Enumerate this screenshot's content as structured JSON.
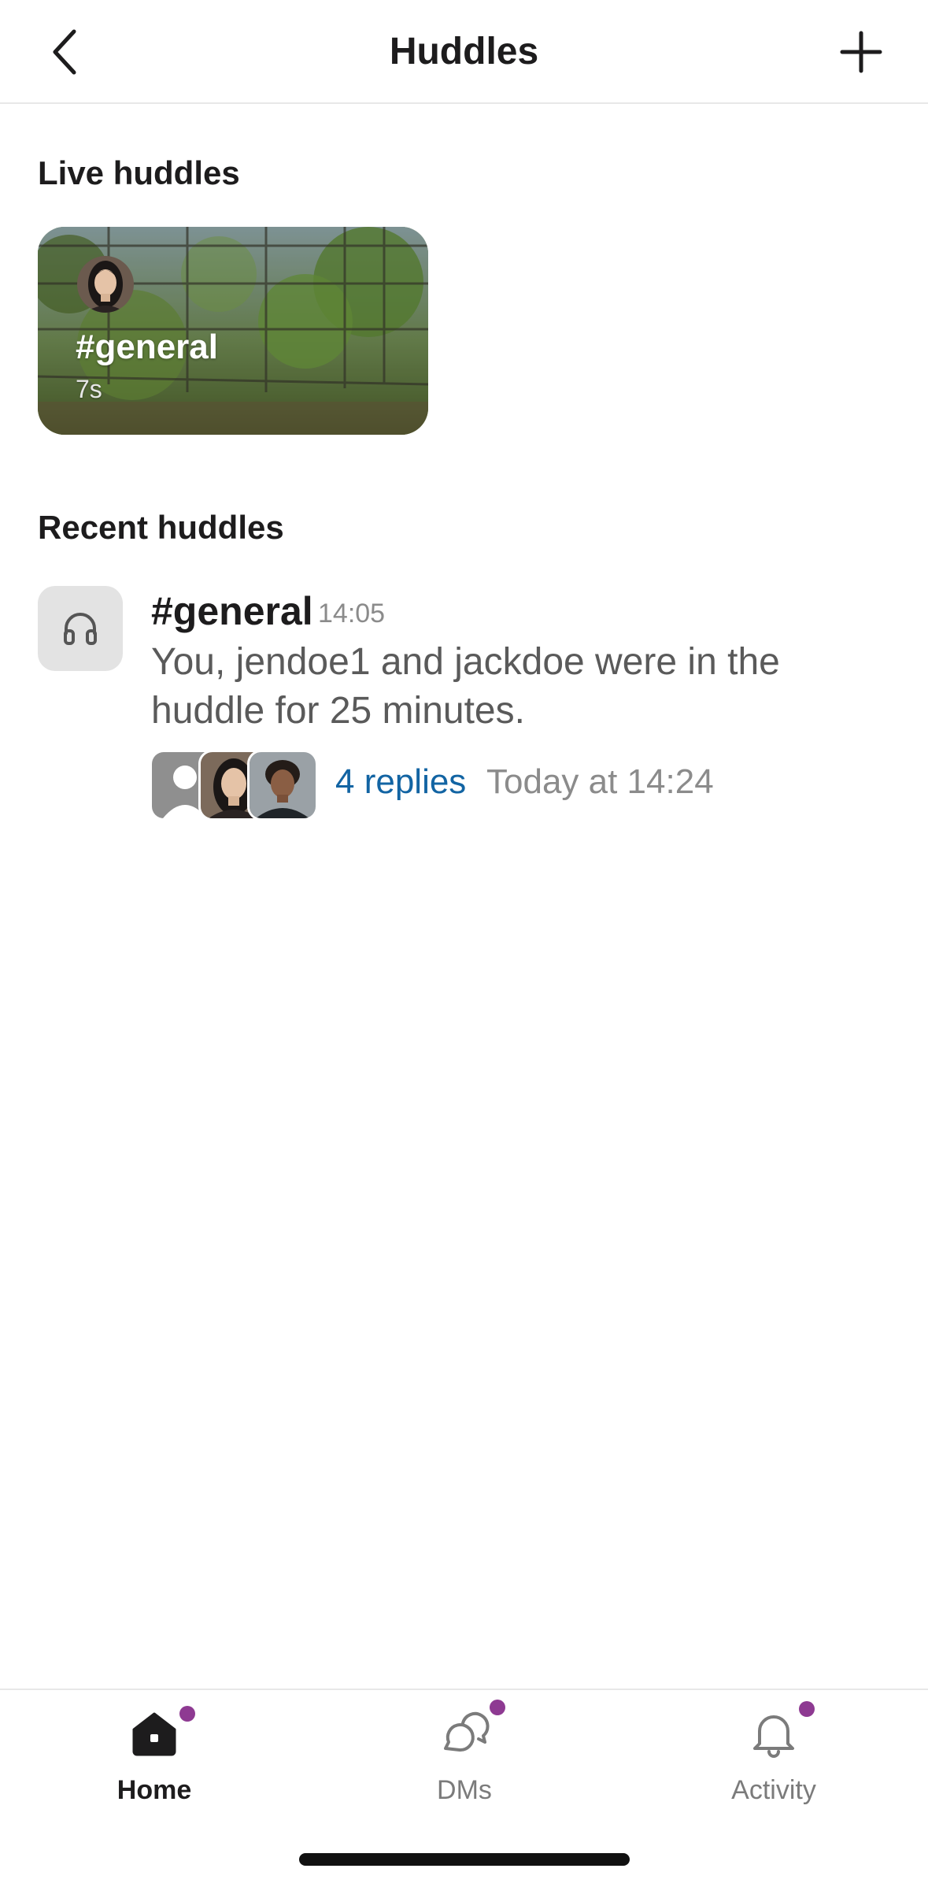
{
  "header": {
    "title": "Huddles",
    "back_icon": "chevron-left-icon",
    "add_icon": "plus-icon"
  },
  "live_huddles": {
    "section_title": "Live huddles",
    "cards": [
      {
        "channel": "#general",
        "duration": "7s",
        "avatar_icon": "woman-avatar"
      }
    ]
  },
  "recent_huddles": {
    "section_title": "Recent huddles",
    "items": [
      {
        "channel": "#general",
        "time": "14:05",
        "summary": "You, jendoe1 and jackdoe were in the huddle for 25 minutes.",
        "replies": "4 replies",
        "last_reply": "Today at 14:24",
        "icon": "headphones-icon"
      }
    ]
  },
  "tabbar": {
    "tabs": [
      {
        "label": "Home",
        "icon": "home-icon",
        "active": true,
        "has_badge": true
      },
      {
        "label": "DMs",
        "icon": "dms-icon",
        "active": false,
        "has_badge": true
      },
      {
        "label": "Activity",
        "icon": "bell-icon",
        "active": false,
        "has_badge": true
      }
    ]
  },
  "colors": {
    "accent_badge": "#8e3a92",
    "link": "#1264a3",
    "muted_text": "#8b8b8b"
  }
}
